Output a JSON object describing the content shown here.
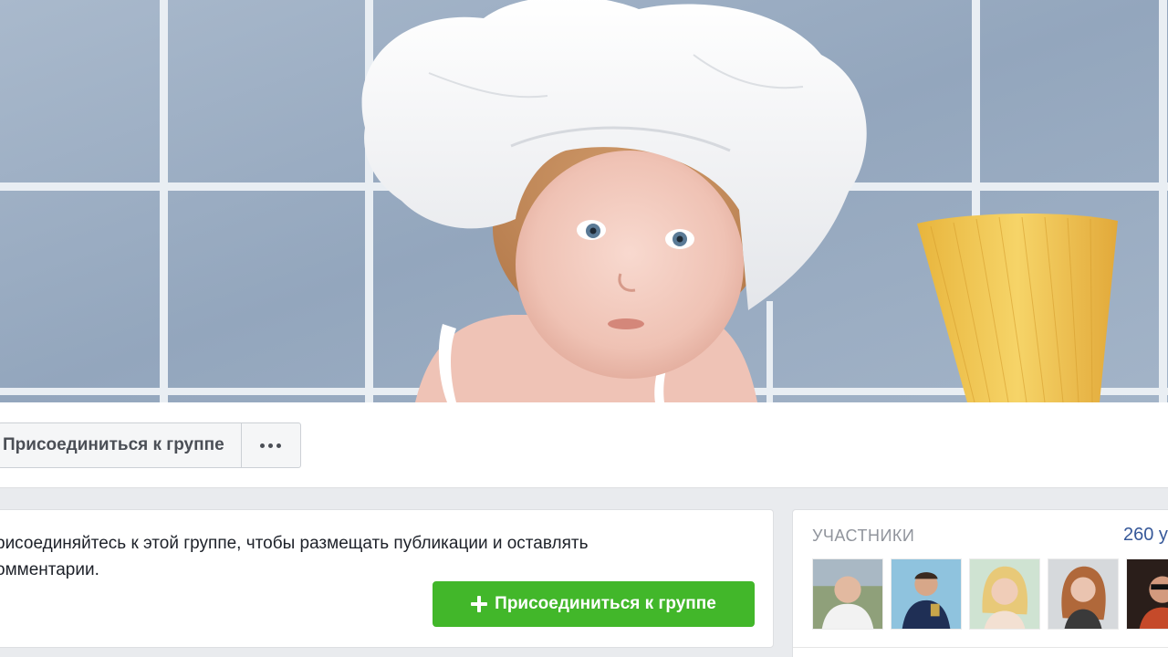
{
  "header": {
    "join_button_label": "Присоединиться к группе",
    "more_button_icon": "ellipsis-icon"
  },
  "join_card": {
    "text": "рисоединяйтесь к этой группе, чтобы размещать публикации и оставлять\nомментарии.",
    "join_button_label": "Присоединиться к группе",
    "join_button_icon": "plus-icon"
  },
  "members": {
    "title": "УЧАСТНИКИ",
    "count": "260 у"
  },
  "colors": {
    "accent_green": "#42b72a",
    "link_blue": "#365899",
    "page_bg": "#e9ebee"
  }
}
